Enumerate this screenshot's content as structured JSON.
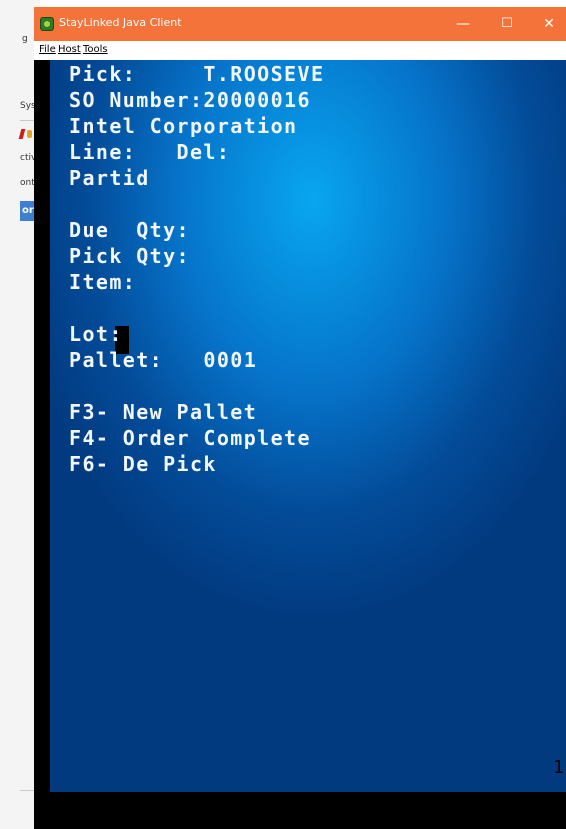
{
  "background_app": {
    "fragments": [
      "g",
      "Sys",
      "ctiv",
      "ont",
      "or"
    ]
  },
  "window": {
    "title": "StayLinked Java Client",
    "controls": {
      "minimize": "—",
      "maximize": "☐",
      "close": "✕"
    }
  },
  "menubar": {
    "items": [
      "File",
      "Host",
      "Tools"
    ]
  },
  "terminal": {
    "lines": [
      "Pick:     T.ROOSEVE",
      "SO Number:20000016",
      "Intel Corporation",
      "Line:   Del:",
      "Partid",
      "",
      "Due  Qty:",
      "Pick Qty:",
      "Item:",
      "",
      "Lot:",
      "Pallet:   0001",
      "",
      "F3- New Pallet",
      "F4- Order Complete",
      "F6- De Pick"
    ],
    "page_number": "1"
  },
  "colors": {
    "titlebar": "#f4733b",
    "terminal_center": "#08a6f0",
    "terminal_edge": "#023a80",
    "text": "#f2f6ff"
  }
}
